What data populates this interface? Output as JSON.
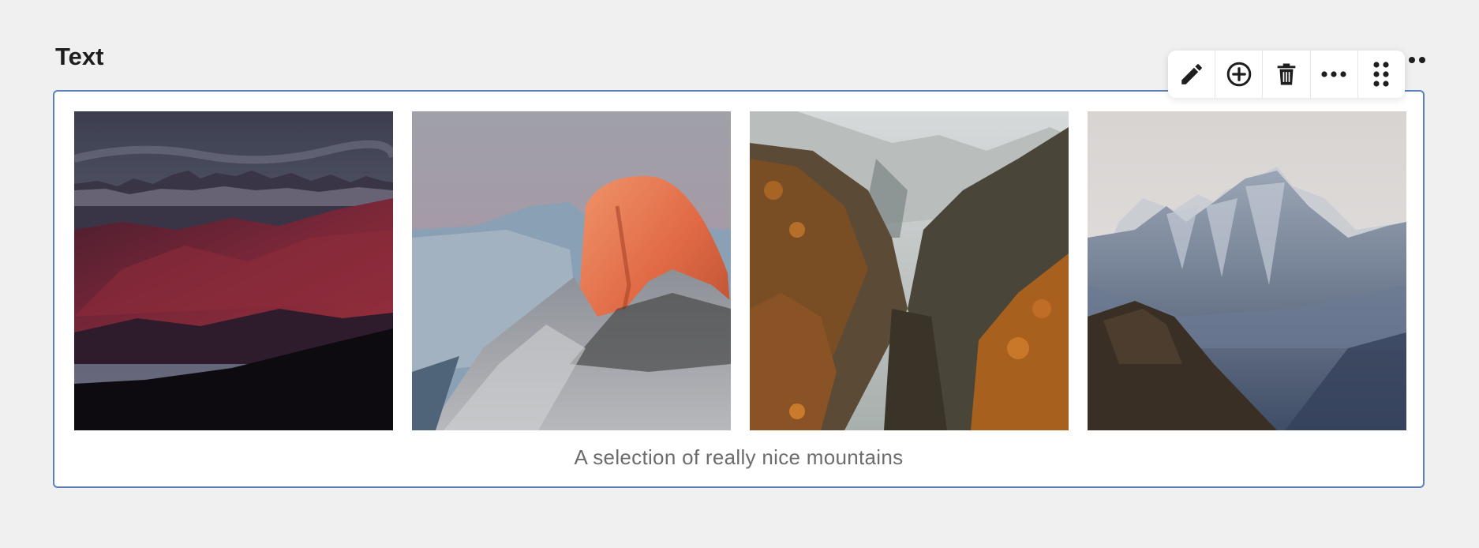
{
  "block": {
    "title": "Text"
  },
  "gallery": {
    "caption": "A selection of really nice mountains",
    "images": [
      {
        "subject": "dusk-red-mountain-range"
      },
      {
        "subject": "half-dome-sunset"
      },
      {
        "subject": "autumn-forest-valley"
      },
      {
        "subject": "snowy-granite-peaks"
      }
    ]
  },
  "toolbar": {
    "buttons": [
      {
        "icon": "pencil-icon",
        "action": "edit"
      },
      {
        "icon": "plus-circle-icon",
        "action": "add"
      },
      {
        "icon": "trash-icon",
        "action": "delete"
      },
      {
        "icon": "ellipsis-icon",
        "action": "more"
      },
      {
        "icon": "drag-handle-icon",
        "action": "move"
      }
    ]
  },
  "colors": {
    "background": "#f0f0f0",
    "card_border": "#5b82b8",
    "caption_text": "#6c6c6c",
    "icon": "#1e1e1e"
  }
}
